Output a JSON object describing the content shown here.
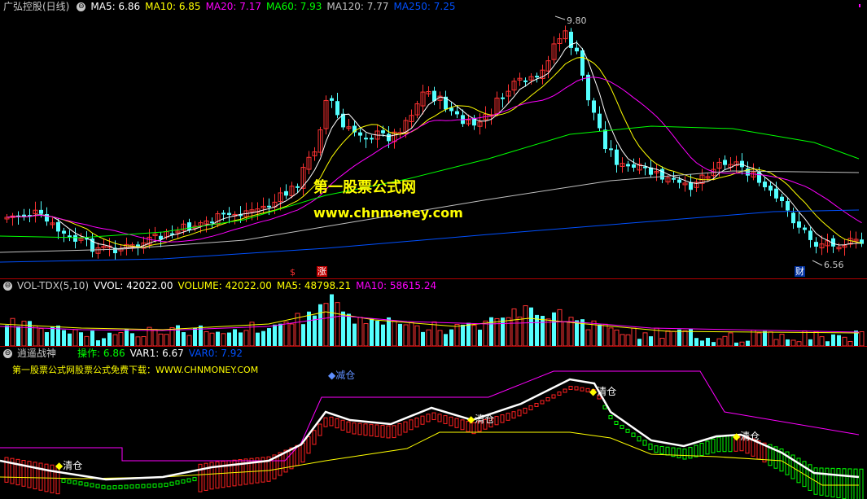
{
  "main": {
    "stock_name": "广弘控股(日线)",
    "ma_items": [
      {
        "label": "MA5: 6.86",
        "color": "#ffffff"
      },
      {
        "label": "MA10: 6.85",
        "color": "#ffff00"
      },
      {
        "label": "MA20: 7.17",
        "color": "#ff00ff"
      },
      {
        "label": "MA60: 7.93",
        "color": "#00ff00"
      },
      {
        "label": "MA120: 7.77",
        "color": "#c0c0c0"
      },
      {
        "label": "MA250: 7.25",
        "color": "#0050ff"
      }
    ],
    "high_label": "9.80",
    "low_label": "6.56",
    "watermark_title": "第一股票公式网",
    "watermark_url": "www.chnmoney.com",
    "marker_s": "$",
    "marker_zhang": "涨",
    "marker_cai": "财",
    "colors": {
      "up": "#ff3232",
      "down": "#54ffff"
    }
  },
  "volume": {
    "title": "VOL-TDX(5,10)",
    "items": [
      {
        "label": "VVOL: 42022.00",
        "color": "#ffffff"
      },
      {
        "label": "VOLUME: 42022.00",
        "color": "#ffff00"
      },
      {
        "label": "MA5: 48798.21",
        "color": "#ffff00"
      },
      {
        "label": "MA10: 58615.24",
        "color": "#ff00ff"
      }
    ]
  },
  "indicator": {
    "title": "逍遥战神",
    "items": [
      {
        "label": "操作: 6.86",
        "color": "#00ff00"
      },
      {
        "label": "VAR1: 6.67",
        "color": "#ffffff"
      },
      {
        "label": "VAR0: 7.92",
        "color": "#0050ff"
      }
    ],
    "ad_text": "第一股票公式网股票公式免费下载：WWW.CHNMONEY.COM",
    "label_jiancang": "减仓",
    "label_qingcang": "清仓"
  }
}
